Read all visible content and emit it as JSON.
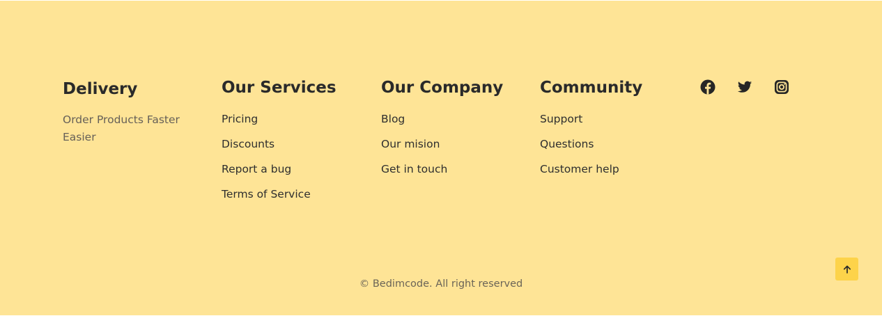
{
  "columns": {
    "delivery": {
      "title": "Delivery",
      "description": "Order Products Faster Easier"
    },
    "services": {
      "title": "Our Services",
      "links": [
        "Pricing",
        "Discounts",
        "Report a bug",
        "Terms of Service"
      ]
    },
    "company": {
      "title": "Our Company",
      "links": [
        "Blog",
        "Our mision",
        "Get in touch"
      ]
    },
    "community": {
      "title": "Community",
      "links": [
        "Support",
        "Questions",
        "Customer help"
      ]
    }
  },
  "social": {
    "icons": [
      "facebook-icon",
      "twitter-icon",
      "instagram-icon"
    ]
  },
  "copyright": "© Bedimcode. All right reserved",
  "back_to_top_icon": "arrow-up-icon",
  "colors": {
    "background": "#fee496",
    "accent": "#fdd34a",
    "text": "#2b2b2b"
  }
}
